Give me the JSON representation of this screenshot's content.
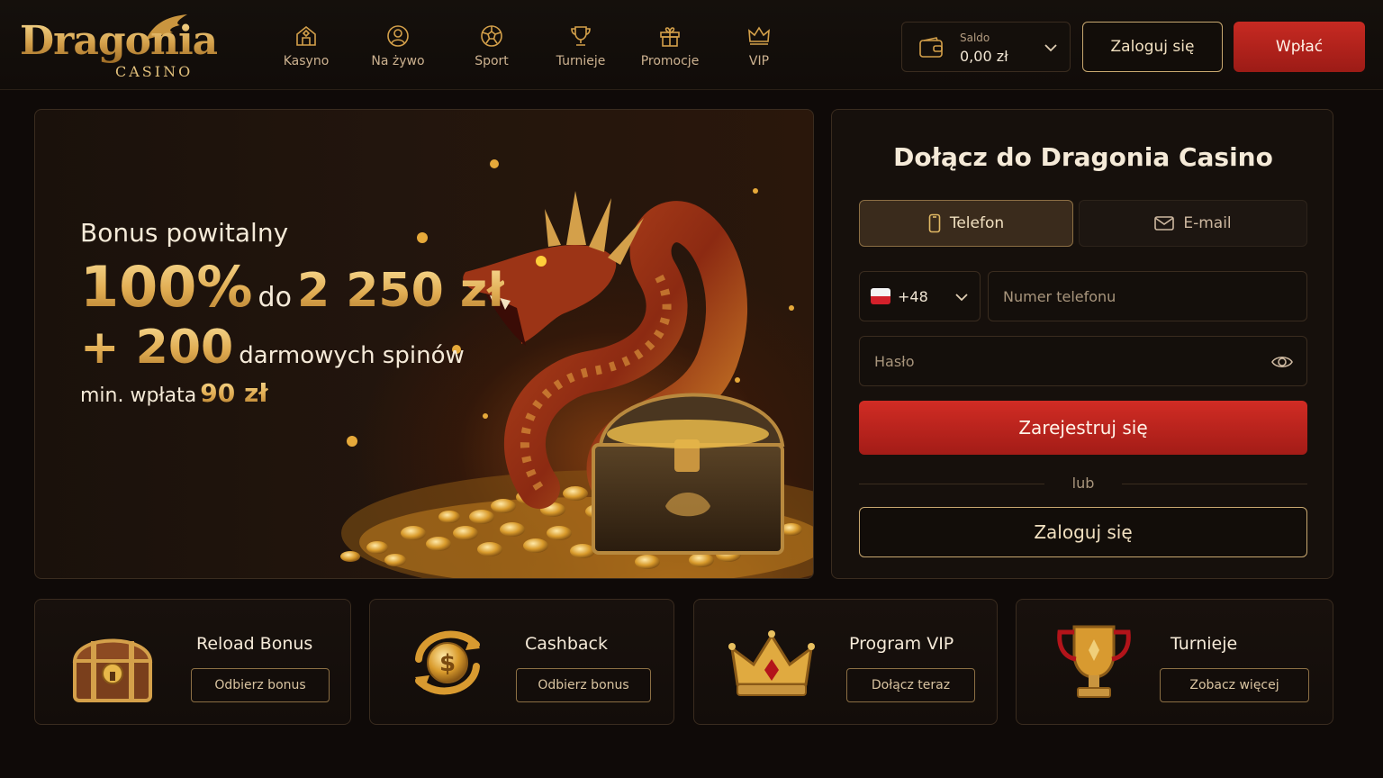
{
  "brand": {
    "name": "Dragonia",
    "sub": "CASINO"
  },
  "nav": {
    "items": [
      {
        "label": "Kasyno",
        "icon": "casino-icon"
      },
      {
        "label": "Na żywo",
        "icon": "live-icon"
      },
      {
        "label": "Sport",
        "icon": "sport-icon"
      },
      {
        "label": "Turnieje",
        "icon": "trophy-icon"
      },
      {
        "label": "Promocje",
        "icon": "gift-icon"
      },
      {
        "label": "VIP",
        "icon": "crown-icon"
      }
    ]
  },
  "header": {
    "balance_label": "Saldo",
    "balance_value": "0,00 zł",
    "login_label": "Zaloguj się",
    "deposit_label": "Wpłać"
  },
  "hero": {
    "pre": "Bonus powitalny",
    "percent": "100%",
    "do": "do",
    "amount": "2 250 zł",
    "spins_num": "+ 200",
    "spins_text": "darmowych spinów",
    "min_text": "min. wpłata",
    "min_value": "90 zł"
  },
  "signup": {
    "title": "Dołącz do Dragonia Casino",
    "tab_phone": "Telefon",
    "tab_email": "E-mail",
    "country_code": "+48",
    "phone_placeholder": "Numer telefonu",
    "password_placeholder": "Hasło",
    "register_label": "Zarejestruj się",
    "or_text": "lub",
    "login_label": "Zaloguj się"
  },
  "cards": [
    {
      "title": "Reload Bonus",
      "button": "Odbierz bonus",
      "icon": "treasure-chest-icon"
    },
    {
      "title": "Cashback",
      "button": "Odbierz bonus",
      "icon": "cashback-coin-icon"
    },
    {
      "title": "Program VIP",
      "button": "Dołącz teraz",
      "icon": "crown-icon"
    },
    {
      "title": "Turnieje",
      "button": "Zobacz więcej",
      "icon": "trophy-icon"
    }
  ],
  "colors": {
    "accent_gold": "#d4a04a",
    "accent_red": "#c72a22",
    "background": "#0f0a08"
  }
}
